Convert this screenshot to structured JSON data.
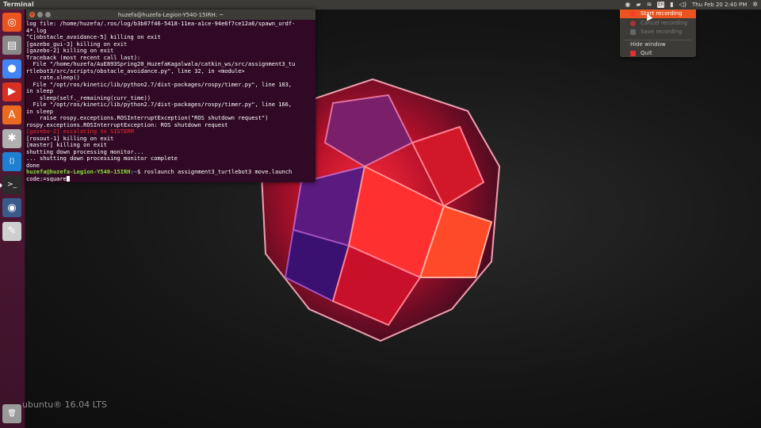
{
  "panel": {
    "app_title": "Terminal",
    "clock": "Thu Feb 20  2:40 PM",
    "indicators": [
      "recorder-icon",
      "camera-icon",
      "wifi-icon",
      "keyboard-icon",
      "battery-icon",
      "volume-icon",
      "gear-icon"
    ]
  },
  "launcher": {
    "items": [
      {
        "name": "ubuntu-dash-icon",
        "glyph": "◎",
        "color": "#e95420"
      },
      {
        "name": "files-icon",
        "glyph": "▤",
        "color": "#8a8a8a"
      },
      {
        "name": "chrome-icon",
        "glyph": "●",
        "color": "#4285f4"
      },
      {
        "name": "media-player-icon",
        "glyph": "▶",
        "color": "#d93025"
      },
      {
        "name": "software-center-icon",
        "glyph": "A",
        "color": "#e96a20"
      },
      {
        "name": "settings-icon",
        "glyph": "✱",
        "color": "#b0b0b0"
      },
      {
        "name": "vscode-icon",
        "glyph": "⟨⟩",
        "color": "#1f7fd1"
      },
      {
        "name": "terminal-icon",
        "glyph": ">_",
        "color": "#2c2c2c"
      },
      {
        "name": "browser-icon",
        "glyph": "◉",
        "color": "#3a5a8c"
      },
      {
        "name": "text-editor-icon",
        "glyph": "✎",
        "color": "#cfcfcf"
      },
      {
        "name": "trash-icon",
        "glyph": "🗑",
        "color": "#9a9a9a"
      }
    ]
  },
  "terminal": {
    "title": "huzefa@huzefa-Legion-Y540-15IRH: ~",
    "lines": [
      {
        "text": "log file: /home/huzefa/.ros/log/b3b07f46-5418-11ea-a1ce-94e6f7ce12a6/spawn_urdf-",
        "cls": ""
      },
      {
        "text": "4*.log",
        "cls": ""
      },
      {
        "text": "^C[obstacle_avoidance-5] killing on exit",
        "cls": ""
      },
      {
        "text": "[gazebo_gui-3] killing on exit",
        "cls": ""
      },
      {
        "text": "[gazebo-2] killing on exit",
        "cls": ""
      },
      {
        "text": "Traceback (most recent call last):",
        "cls": ""
      },
      {
        "text": "  File \"/home/huzefa/AuE893Spring20_HuzefaKagalwala/catkin_ws/src/assignment3_tu",
        "cls": ""
      },
      {
        "text": "rtlebot3/src/scripts/obstacle_avoidance.py\", line 32, in <module>",
        "cls": ""
      },
      {
        "text": "    rate.sleep()",
        "cls": ""
      },
      {
        "text": "  File \"/opt/ros/kinetic/lib/python2.7/dist-packages/rospy/timer.py\", line 103,",
        "cls": ""
      },
      {
        "text": "in sleep",
        "cls": ""
      },
      {
        "text": "    sleep(self._remaining(curr_time))",
        "cls": ""
      },
      {
        "text": "  File \"/opt/ros/kinetic/lib/python2.7/dist-packages/rospy/timer.py\", line 166,",
        "cls": ""
      },
      {
        "text": "in sleep",
        "cls": ""
      },
      {
        "text": "    raise rospy.exceptions.ROSInterruptException(\"ROS shutdown request\")",
        "cls": ""
      },
      {
        "text": "rospy.exceptions.ROSInterruptException: ROS shutdown request",
        "cls": ""
      },
      {
        "text": "[gazebo-2] escalating to SIGTERM",
        "cls": "red"
      },
      {
        "text": "[rosout-1] killing on exit",
        "cls": ""
      },
      {
        "text": "[master] killing on exit",
        "cls": ""
      },
      {
        "text": "shutting down processing monitor...",
        "cls": ""
      },
      {
        "text": "... shutting down processing monitor complete",
        "cls": ""
      },
      {
        "text": "done",
        "cls": ""
      }
    ],
    "prompt_user": "huzefa@huzefa-Legion-Y540-15IRH",
    "prompt_path": ":~",
    "prompt_symbol": "$ ",
    "command": "roslaunch assignment3_turtlebot3 move.launch",
    "command_cont": "code:=square"
  },
  "menu": {
    "start": "Start recording",
    "cancel": "Cancel recording",
    "save": "Save recording",
    "hide": "Hide window",
    "quit": "Quit"
  },
  "watermark": "ubuntu® 16.04 LTS"
}
